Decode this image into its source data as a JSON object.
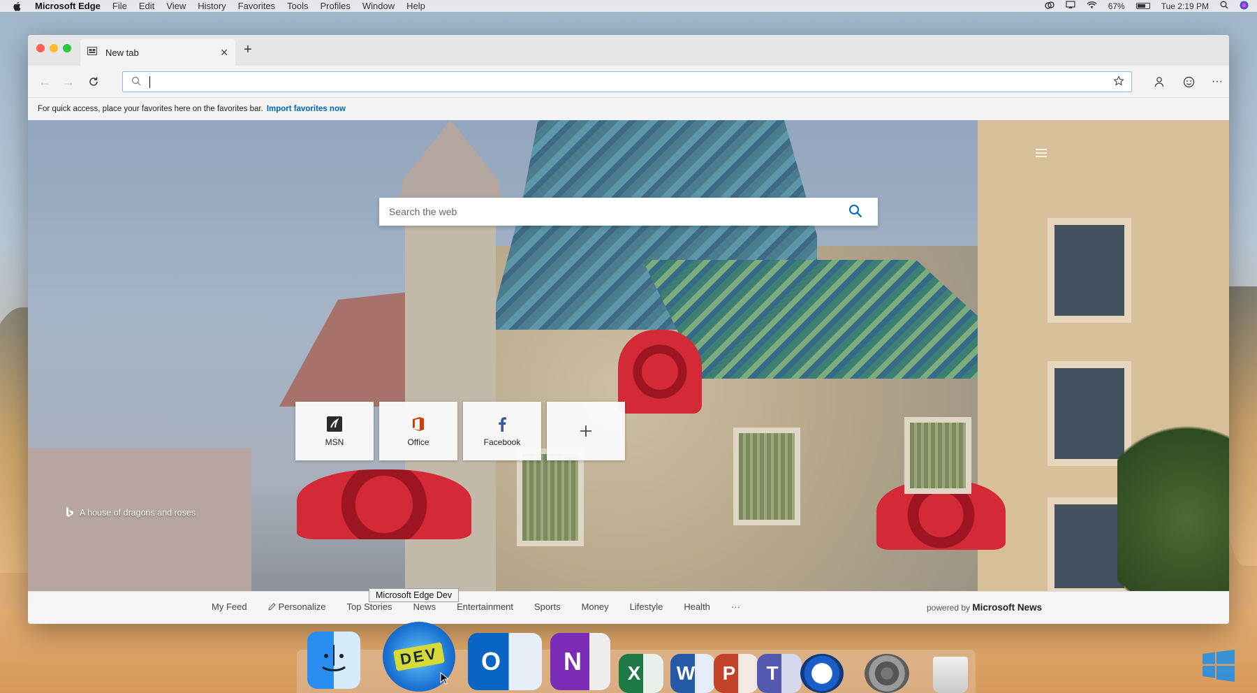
{
  "menubar": {
    "app_name": "Microsoft Edge",
    "items": [
      "File",
      "Edit",
      "View",
      "History",
      "Favorites",
      "Tools",
      "Profiles",
      "Window",
      "Help"
    ],
    "battery_percent": "67%",
    "battery_level": 0.67,
    "clock": "Tue 2:19 PM"
  },
  "browser": {
    "tab_title": "New tab",
    "address_value": "",
    "favorites_message": "For quick access, place your favorites here on the favorites bar.",
    "import_link": "Import favorites now"
  },
  "newtab": {
    "search_placeholder": "Search the web",
    "tiles": [
      {
        "label": "MSN",
        "icon": "msn-icon"
      },
      {
        "label": "Office",
        "icon": "office-icon"
      },
      {
        "label": "Facebook",
        "icon": "facebook-icon"
      },
      {
        "label": "",
        "icon": "add-icon"
      }
    ],
    "image_credit": "A house of dragons and roses",
    "feed_tabs": [
      "My Feed",
      "Personalize",
      "Top Stories",
      "News",
      "Entertainment",
      "Sports",
      "Money",
      "Lifestyle",
      "Health",
      "···"
    ],
    "powered_by_prefix": "powered by",
    "powered_by_brand": "Microsoft News"
  },
  "tooltip": "Microsoft Edge Dev",
  "dock": {
    "icons": [
      "finder-icon",
      "edge-dev-icon",
      "outlook-icon",
      "onenote-icon",
      "excel-icon",
      "word-icon",
      "powerpoint-icon",
      "teams-icon",
      "quicktime-icon",
      "system-preferences-icon",
      "trash-icon"
    ],
    "edge_dev_badge": "DEV"
  },
  "colors": {
    "accent": "#0067b8",
    "office": "#d83b01",
    "facebook": "#3b5998"
  }
}
